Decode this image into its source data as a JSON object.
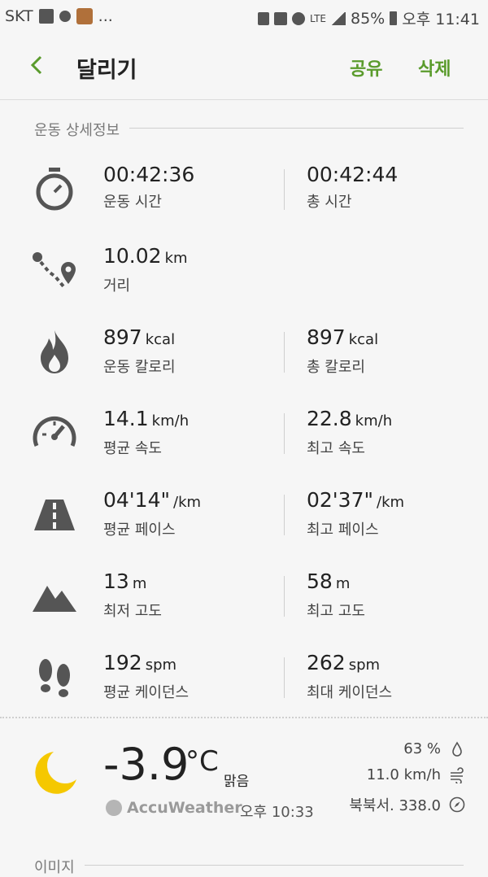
{
  "status": {
    "carrier": "SKT",
    "extra": "...",
    "network": "LTE",
    "battery": "85%",
    "time": "오후 11:41"
  },
  "appbar": {
    "title": "달리기",
    "share": "공유",
    "delete": "삭제"
  },
  "section": {
    "title": "운동 상세정보"
  },
  "stats": [
    {
      "icon": "stopwatch-icon",
      "left": {
        "value": "00:42:36",
        "unit": "",
        "label": "운동 시간"
      },
      "right": {
        "value": "00:42:44",
        "unit": "",
        "label": "총 시간"
      }
    },
    {
      "icon": "route-icon",
      "left": {
        "value": "10.02",
        "unit": "km",
        "label": "거리"
      }
    },
    {
      "icon": "flame-icon",
      "left": {
        "value": "897",
        "unit": "kcal",
        "label": "운동 칼로리"
      },
      "right": {
        "value": "897",
        "unit": "kcal",
        "label": "총 칼로리"
      }
    },
    {
      "icon": "speedometer-icon",
      "left": {
        "value": "14.1",
        "unit": "km/h",
        "label": "평균 속도"
      },
      "right": {
        "value": "22.8",
        "unit": "km/h",
        "label": "최고 속도"
      }
    },
    {
      "icon": "road-icon",
      "left": {
        "value": "04'14\"",
        "unit": "/km",
        "label": "평균 페이스"
      },
      "right": {
        "value": "02'37\"",
        "unit": "/km",
        "label": "최고 페이스"
      }
    },
    {
      "icon": "mountain-icon",
      "left": {
        "value": "13",
        "unit": "m",
        "label": "최저 고도"
      },
      "right": {
        "value": "58",
        "unit": "m",
        "label": "최고 고도"
      }
    },
    {
      "icon": "footprints-icon",
      "left": {
        "value": "192",
        "unit": "spm",
        "label": "평균 케이던스"
      },
      "right": {
        "value": "262",
        "unit": "spm",
        "label": "최대 케이던스"
      }
    }
  ],
  "weather": {
    "temperature": "-3.9",
    "unit": "°C",
    "condition": "맑음",
    "provider": "AccuWeather",
    "time": "오후 10:33",
    "humidity": "63 %",
    "wind": "11.0 km/h",
    "direction": "북북서. 338.0"
  },
  "bottom_section": {
    "title": "이미지"
  },
  "colors": {
    "accent": "#5a9b2c",
    "moon": "#f5c800",
    "icon": "#555555"
  }
}
